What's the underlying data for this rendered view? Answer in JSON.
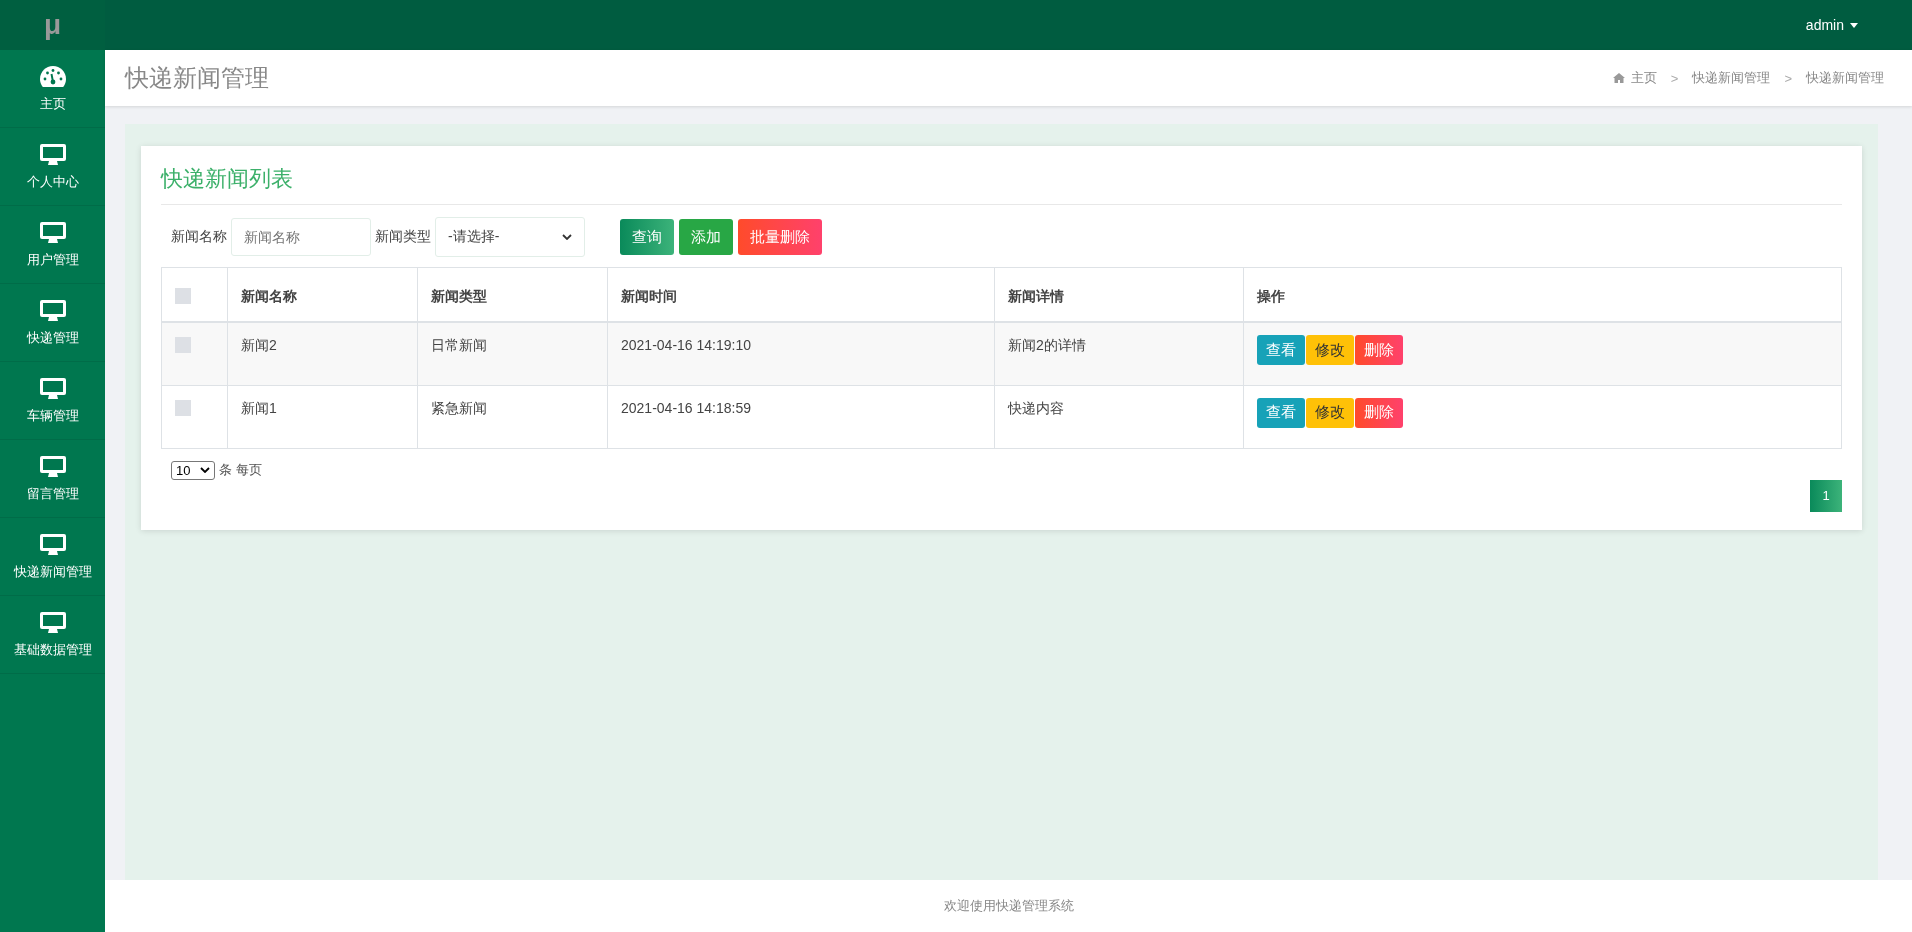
{
  "logo": "μ",
  "sidebar": {
    "items": [
      {
        "label": "主页",
        "kind": "dashboard"
      },
      {
        "label": "个人中心",
        "kind": "monitor"
      },
      {
        "label": "用户管理",
        "kind": "monitor"
      },
      {
        "label": "快递管理",
        "kind": "monitor"
      },
      {
        "label": "车辆管理",
        "kind": "monitor"
      },
      {
        "label": "留言管理",
        "kind": "monitor"
      },
      {
        "label": "快递新闻管理",
        "kind": "monitor"
      },
      {
        "label": "基础数据管理",
        "kind": "monitor"
      }
    ]
  },
  "topbar": {
    "user": "admin"
  },
  "page_header": {
    "title": "快递新闻管理",
    "breadcrumb": [
      "主页",
      "快递新闻管理",
      "快递新闻管理"
    ],
    "separator": ">"
  },
  "card": {
    "title": "快递新闻列表",
    "filters": [
      {
        "label": "新闻名称",
        "kind": "input",
        "placeholder": "新闻名称"
      },
      {
        "label": "新闻类型",
        "kind": "select",
        "value": "-请选择-"
      }
    ],
    "buttons": [
      {
        "label": "查询",
        "kind": "query"
      },
      {
        "label": "添加",
        "kind": "add"
      },
      {
        "label": "批量删除",
        "kind": "danger"
      }
    ],
    "table": {
      "select_all_checked": false,
      "columns": [
        "新闻名称",
        "新闻类型",
        "新闻时间",
        "新闻详情",
        "操作"
      ],
      "rows": [
        {
          "checked": false,
          "cells": [
            "新闻2",
            "日常新闻",
            "2021-04-16 14:19:10",
            "新闻2的详情"
          ],
          "actions": [
            {
              "label": "查看",
              "kind": "view"
            },
            {
              "label": "修改",
              "kind": "edit"
            },
            {
              "label": "删除",
              "kind": "danger"
            }
          ]
        },
        {
          "checked": false,
          "cells": [
            "新闻1",
            "紧急新闻",
            "2021-04-16 14:18:59",
            "快递内容"
          ],
          "actions": [
            {
              "label": "查看",
              "kind": "view"
            },
            {
              "label": "修改",
              "kind": "edit"
            },
            {
              "label": "删除",
              "kind": "danger"
            }
          ]
        }
      ]
    },
    "page_size": {
      "value": "10",
      "suffix": "条 每页"
    },
    "pages": [
      {
        "label": "1",
        "selected": true
      }
    ]
  },
  "footer": "欢迎使用快递管理系统"
}
